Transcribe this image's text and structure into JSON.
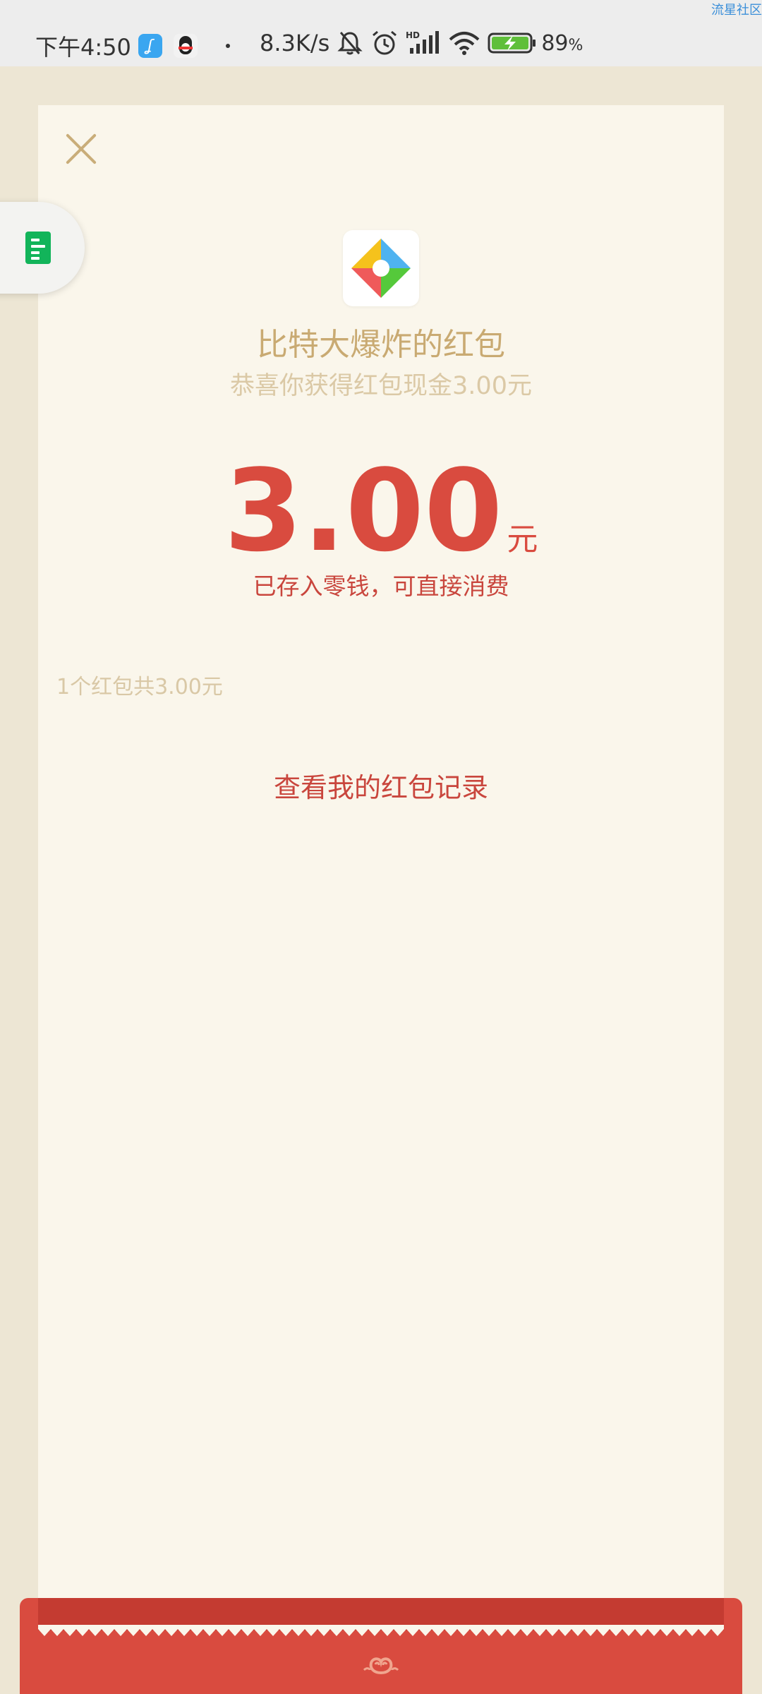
{
  "status_bar": {
    "watermark": "流星社区",
    "time": "下午4:50",
    "network_speed": "8.3K/s",
    "battery_percent": "89",
    "battery_unit": "%",
    "icons": [
      "app-notification-icon",
      "qq-icon",
      "mute-bell-icon",
      "alarm-icon",
      "hd-signal-icon",
      "wifi-icon",
      "battery-charging-icon"
    ]
  },
  "red_packet": {
    "sender_title": "比特大爆炸的红包",
    "congrats": "恭喜你获得红包现金3.00元",
    "amount": "3.00",
    "unit": "元",
    "saved_note": "已存入零钱，可直接消费",
    "summary": "1个红包共3.00元",
    "records_link": "查看我的红包记录"
  },
  "colors": {
    "accent_red": "#d94b3f",
    "gold": "#c9aa72",
    "card_bg": "#faf6eb",
    "page_bg": "#ede6d4"
  }
}
